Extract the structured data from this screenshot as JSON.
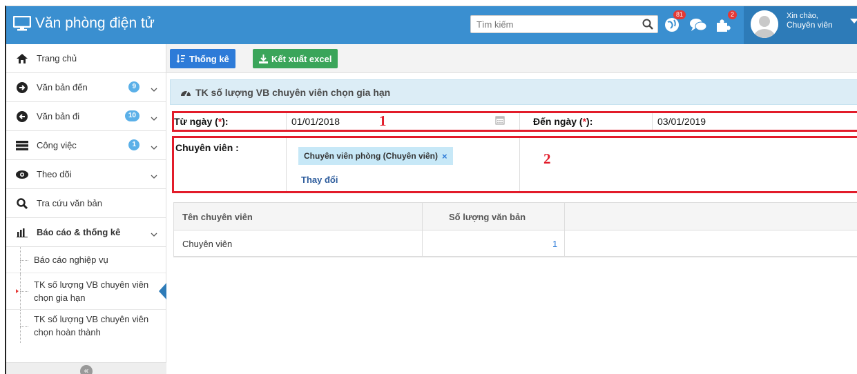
{
  "app": {
    "title": "Văn phòng điện tử"
  },
  "search": {
    "placeholder": "Tìm kiếm"
  },
  "notifications": {
    "count1": "81",
    "count2": "2"
  },
  "user": {
    "greeting": "Xin chào,",
    "name": "Chuyên viên"
  },
  "sidebar": {
    "items": [
      {
        "label": "Trang chủ",
        "icon": "home-icon"
      },
      {
        "label": "Văn bản đến",
        "icon": "arrow-right-circle-icon",
        "count": "9"
      },
      {
        "label": "Văn bản đi",
        "icon": "arrow-left-circle-icon",
        "count": "10"
      },
      {
        "label": "Công việc",
        "icon": "list-icon",
        "count": "1"
      },
      {
        "label": "Theo dõi",
        "icon": "eye-icon"
      },
      {
        "label": "Tra cứu văn bản",
        "icon": "search-icon"
      },
      {
        "label": "Báo cáo & thống kê",
        "icon": "bar-chart-icon"
      }
    ],
    "sub_items": [
      {
        "label": "Báo cáo nghiệp vụ"
      },
      {
        "label": "TK số lượng VB chuyên viên chọn gia hạn"
      },
      {
        "label": "TK số lượng VB chuyên viên chọn hoàn thành"
      }
    ],
    "collapse_glyph": "«"
  },
  "toolbar": {
    "stats_label": "Thống kê",
    "export_label": "Kết xuất excel"
  },
  "panel": {
    "title": "TK số lượng VB chuyên viên chọn gia hạn"
  },
  "form": {
    "from_label": "Từ ngày (",
    "to_label": "Đến ngày (",
    "req_mark": "*",
    "label_close": "):",
    "from_value": "01/01/2018",
    "to_value": "03/01/2019",
    "staff_label": "Chuyên viên :",
    "staff_tag": "Chuyên viên phòng (Chuyên viên)",
    "tag_remove": "×",
    "change_link": "Thay đổi"
  },
  "annotations": {
    "one": "1",
    "two": "2"
  },
  "table": {
    "headers": [
      "Tên chuyên viên",
      "Số lượng văn bản"
    ],
    "rows": [
      {
        "name": "Chuyên viên",
        "count": "1"
      }
    ]
  },
  "colors": {
    "header": "#3a8fd0",
    "accent_red": "#e21c2a",
    "btn_blue": "#2d7bd8",
    "btn_green": "#3aa55a"
  }
}
